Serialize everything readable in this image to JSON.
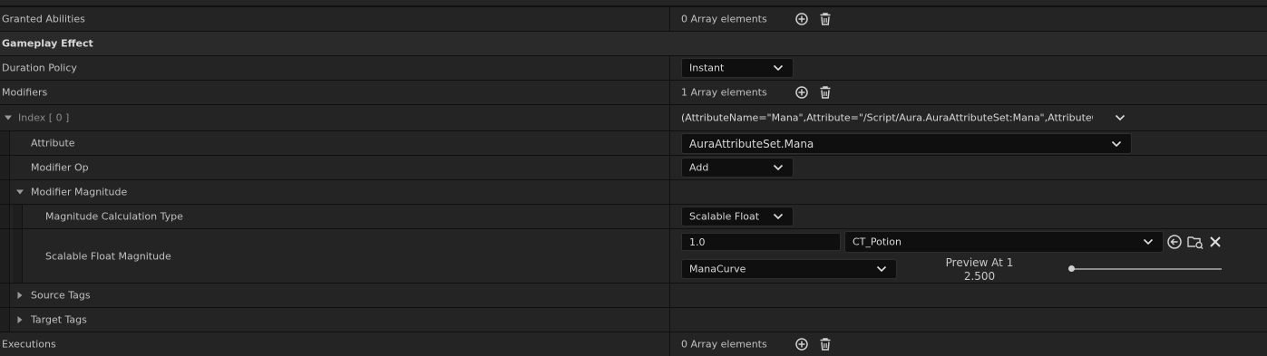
{
  "rows": {
    "granted_abilities": {
      "label": "Granted Abilities",
      "value": "0 Array elements"
    },
    "gameplay_effect": {
      "label": "Gameplay Effect"
    },
    "duration_policy": {
      "label": "Duration Policy",
      "value": "Instant"
    },
    "modifiers": {
      "label": "Modifiers",
      "value": "1 Array elements"
    },
    "index": {
      "label": "Index [ 0 ]",
      "value": "(AttributeName=\"Mana\",Attribute=\"/Script/Aura.AuraAttributeSet:Mana\",AttributeOwner=/Sc"
    },
    "attribute": {
      "label": "Attribute",
      "value": "AuraAttributeSet.Mana"
    },
    "modifier_op": {
      "label": "Modifier Op",
      "value": "Add"
    },
    "modifier_magnitude": {
      "label": "Modifier Magnitude"
    },
    "magnitude_calc_type": {
      "label": "Magnitude Calculation Type",
      "value": "Scalable Float"
    },
    "scalable_float": {
      "label": "Scalable Float Magnitude",
      "value": "1.0",
      "curve_table": "CT_Potion",
      "row_name": "ManaCurve",
      "preview_label": "Preview At 1",
      "preview_value": "2.500",
      "preview_slider": 0
    },
    "source_tags": {
      "label": "Source Tags"
    },
    "target_tags": {
      "label": "Target Tags"
    },
    "executions": {
      "label": "Executions",
      "value": "0 Array elements"
    }
  },
  "icons": {
    "add": "add-element-icon",
    "delete": "delete-all-icon",
    "chevron": "chevron-down-icon",
    "use_selected": "use-selected-asset-icon",
    "browse": "browse-asset-icon",
    "clear": "clear-icon"
  },
  "colors": {
    "background": "#242424",
    "field": "#0f0f0f",
    "text": "#c0c0c0"
  }
}
